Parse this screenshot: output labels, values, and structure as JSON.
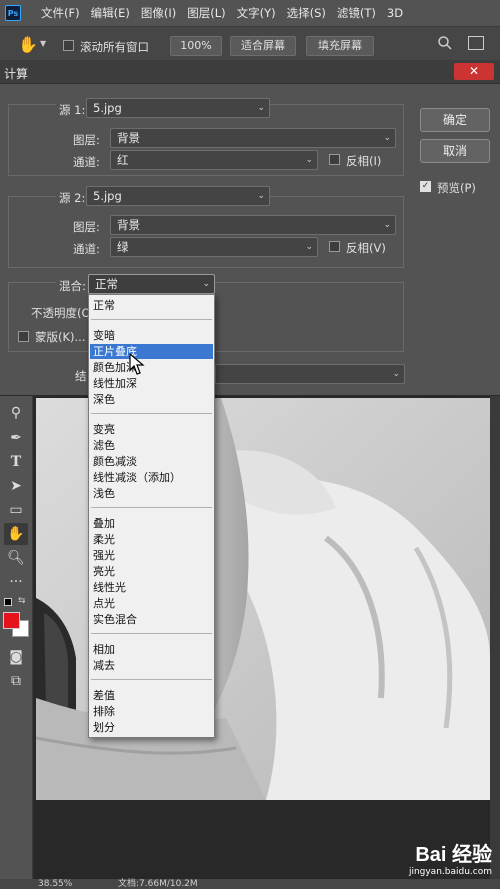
{
  "menubar": {
    "logo": "Ps",
    "items": [
      "文件(F)",
      "编辑(E)",
      "图像(I)",
      "图层(L)",
      "文字(Y)",
      "选择(S)",
      "滤镜(T)",
      "3D"
    ]
  },
  "optionsbar": {
    "scroll_all_label": "滚动所有窗口",
    "zoom_value": "100%",
    "fit_screen_label": "适合屏幕",
    "fill_screen_label": "填充屏幕"
  },
  "dialog": {
    "title": "计算",
    "close_label": "✕",
    "source1": {
      "label": "源 1:",
      "file": "5.jpg",
      "layer_label": "图层:",
      "layer": "背景",
      "channel_label": "通道:",
      "channel": "红",
      "invert_label": "反相(I)"
    },
    "source2": {
      "label": "源 2:",
      "file": "5.jpg",
      "layer_label": "图层:",
      "layer": "背景",
      "channel_label": "通道:",
      "channel": "绿",
      "invert_label": "反相(V)"
    },
    "blend": {
      "label": "混合:",
      "value": "正常",
      "opacity_label": "不透明度(O)",
      "mask_label": "蒙版(K)...",
      "result_label": "结"
    },
    "ok_label": "确定",
    "cancel_label": "取消",
    "preview_label": "预览(P)",
    "preview_checked": true
  },
  "blend_modes": [
    [
      "正常"
    ],
    [
      "变暗",
      "正片叠底",
      "颜色加深",
      "线性加深",
      "深色"
    ],
    [
      "变亮",
      "滤色",
      "颜色减淡",
      "线性减淡（添加）",
      "浅色"
    ],
    [
      "叠加",
      "柔光",
      "强光",
      "亮光",
      "线性光",
      "点光",
      "实色混合"
    ],
    [
      "相加",
      "减去"
    ],
    [
      "差值",
      "排除",
      "划分"
    ]
  ],
  "highlighted_mode": "正片叠底",
  "statusbar": {
    "zoom": "38.55%",
    "doc": "文档:7.66M/10.2M"
  },
  "watermark": {
    "brand": "Bai 经验",
    "url": "jingyan.baidu.com"
  }
}
